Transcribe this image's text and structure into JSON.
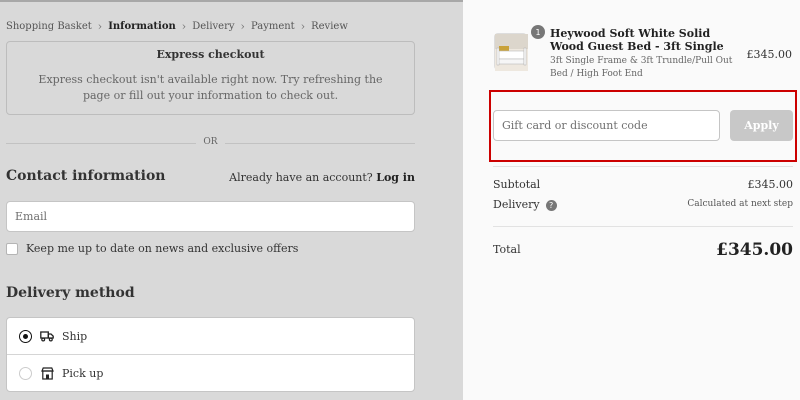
{
  "breadcrumb": [
    {
      "label": "Shopping Basket",
      "active": false
    },
    {
      "label": "Information",
      "active": true
    },
    {
      "label": "Delivery",
      "active": false
    },
    {
      "label": "Payment",
      "active": false
    },
    {
      "label": "Review",
      "active": false
    }
  ],
  "express": {
    "title": "Express checkout",
    "message": "Express checkout isn't available right now. Try refreshing the page or fill out your information to check out."
  },
  "divider_text": "OR",
  "contact": {
    "title": "Contact information",
    "account_prompt": "Already have an account?",
    "login_label": "Log in",
    "email_placeholder": "Email",
    "newsletter_label": "Keep me up to date on news and exclusive offers",
    "newsletter_checked": false
  },
  "delivery": {
    "title": "Delivery method",
    "options": [
      {
        "label": "Ship",
        "icon": "truck-icon",
        "selected": true
      },
      {
        "label": "Pick up",
        "icon": "store-icon",
        "selected": false
      }
    ]
  },
  "order": {
    "item": {
      "quantity": "1",
      "name": "Heywood Soft White Solid Wood Guest Bed - 3ft Single",
      "variant": "3ft Single Frame & 3ft Trundle/Pull Out Bed / High Foot End",
      "price": "£345.00"
    },
    "discount_placeholder": "Gift card or discount code",
    "apply_label": "Apply",
    "subtotal_label": "Subtotal",
    "subtotal_value": "£345.00",
    "delivery_label": "Delivery",
    "delivery_value": "Calculated at next step",
    "total_label": "Total",
    "total_value": "£345.00"
  },
  "colors": {
    "left_bg": "#d9d9d9",
    "right_bg": "#fafafa",
    "highlight_border": "#cc0000",
    "apply_bg": "#c8c8c8"
  }
}
